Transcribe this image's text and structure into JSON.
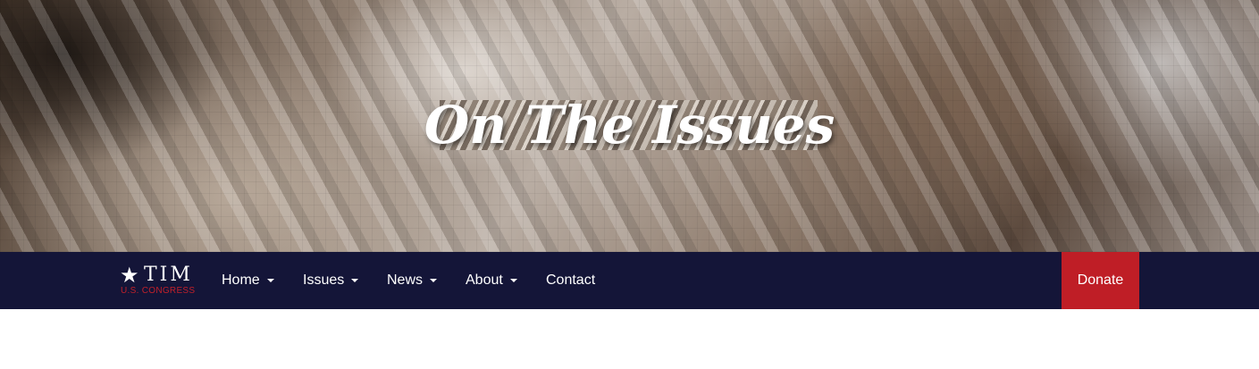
{
  "hero": {
    "title": "On The Issues"
  },
  "brand": {
    "star": "★",
    "name": "TIM",
    "subtitle": "U.S. CONGRESS"
  },
  "nav": {
    "items": [
      {
        "label": "Home",
        "has_dropdown": true
      },
      {
        "label": "Issues",
        "has_dropdown": true
      },
      {
        "label": "News",
        "has_dropdown": true
      },
      {
        "label": "About",
        "has_dropdown": true
      },
      {
        "label": "Contact",
        "has_dropdown": false
      }
    ],
    "donate_label": "Donate"
  },
  "colors": {
    "navbar": "#141538",
    "donate": "#bf1e26",
    "brand_subtitle": "#c0202a",
    "text": "#ffffff"
  }
}
